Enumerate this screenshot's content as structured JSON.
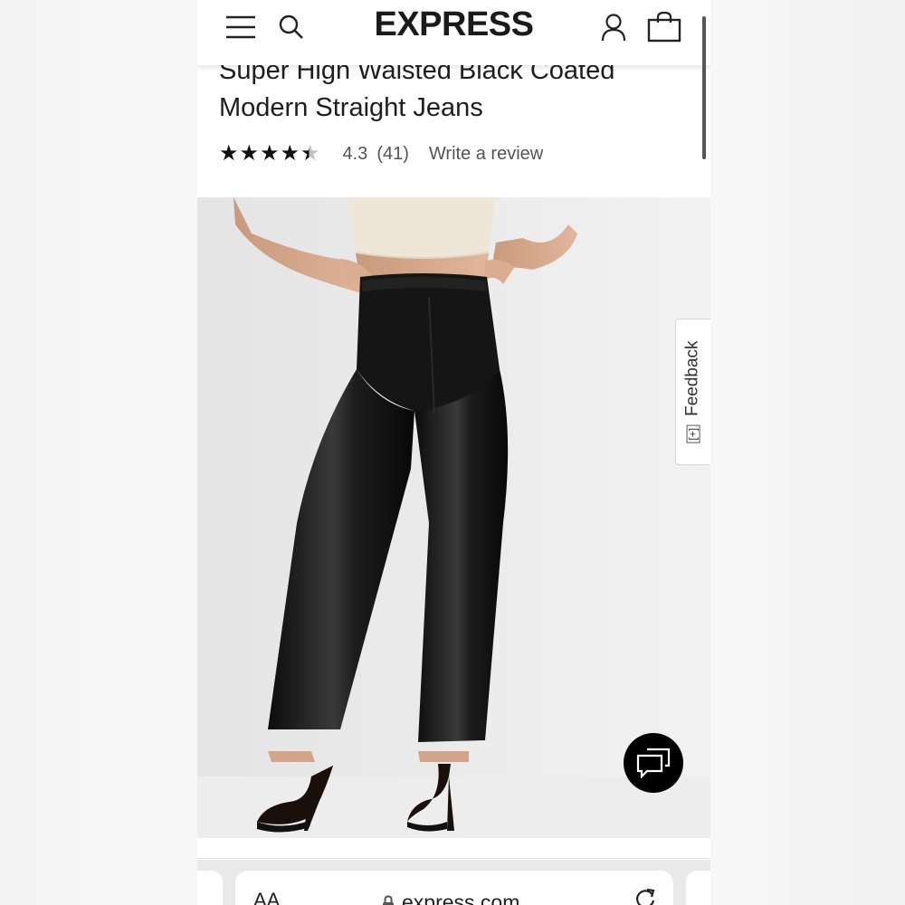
{
  "site": {
    "logo": "EXPRESS"
  },
  "header": {
    "menu_icon": "hamburger-menu-icon",
    "search_icon": "search-icon",
    "account_icon": "account-icon",
    "bag_icon": "shopping-bag-icon"
  },
  "product": {
    "title": "Super High Waisted Black Coated Modern Straight Jeans",
    "rating": {
      "value": "4.3",
      "count": "(41)",
      "stars_filled_fraction": 0.86,
      "write_review": "Write a review"
    }
  },
  "feedback": {
    "label": "Feedback",
    "plus": "[+]"
  },
  "chat": {
    "icon": "chat-bubbles-icon"
  },
  "browser": {
    "aa_label": "AA",
    "url": "express.com",
    "lock_icon": "lock-icon",
    "reload_icon": "reload-icon"
  },
  "colors": {
    "header_bg": "#ffffff",
    "text_primary": "#1e1e1e",
    "text_secondary": "#555555",
    "chat_button": "#000000",
    "pants": "#141414",
    "top_lace": "#efe6d8"
  }
}
